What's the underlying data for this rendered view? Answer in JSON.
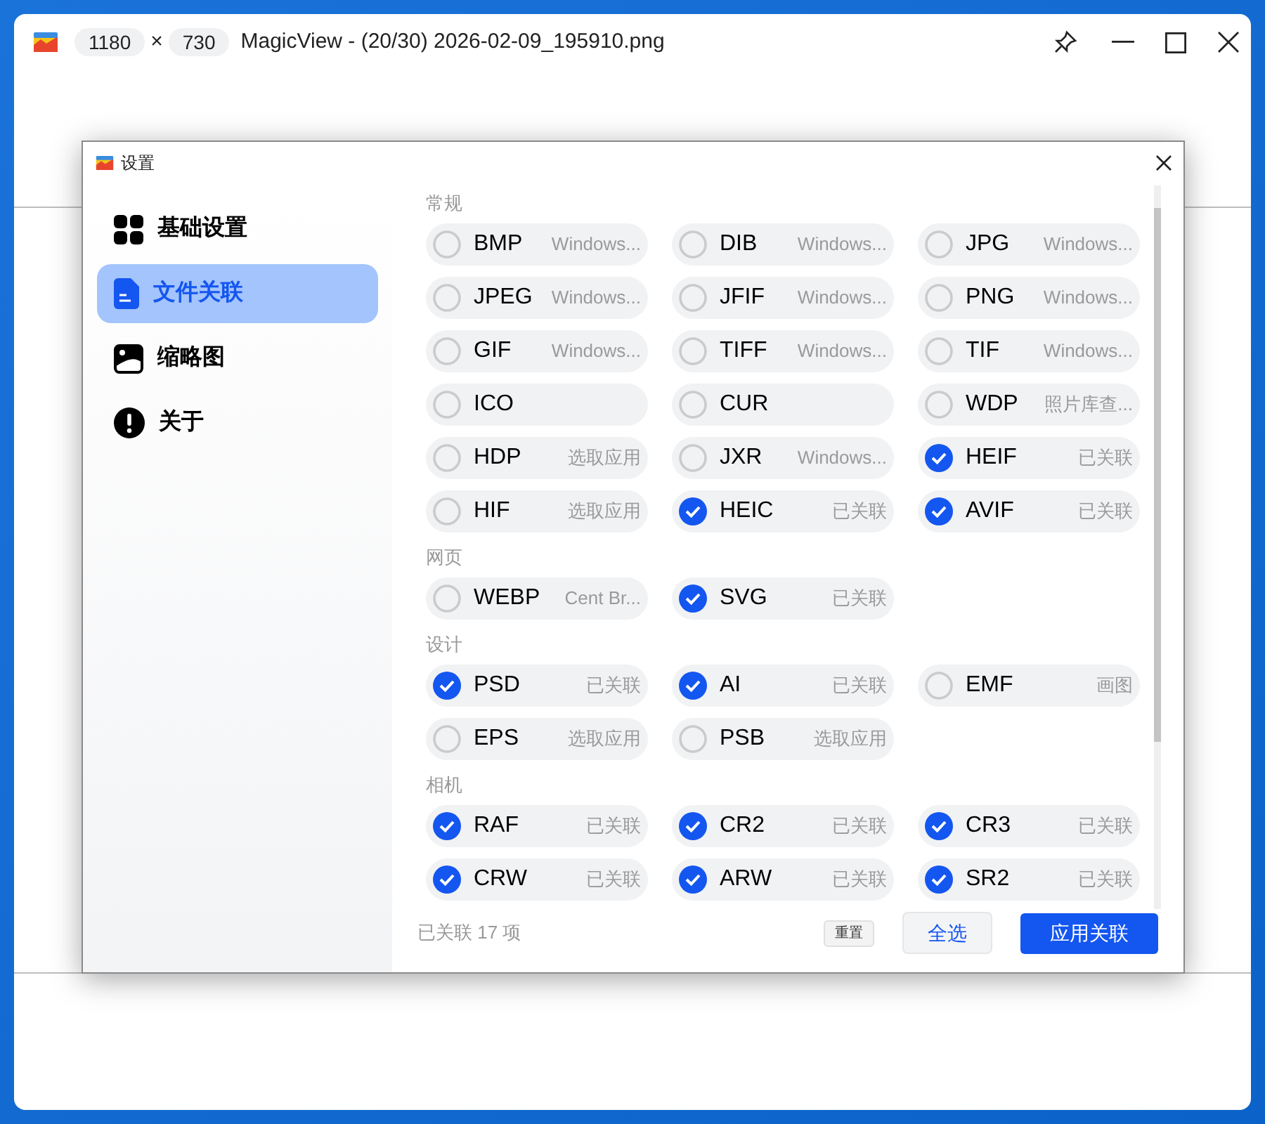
{
  "window": {
    "width_chip": "1180",
    "times": "×",
    "height_chip": "730",
    "title": "MagicView - (20/30) 2026-02-09_195910.png"
  },
  "dialog": {
    "title": "设置",
    "sidebar": [
      {
        "label": "基础设置",
        "selected": false
      },
      {
        "label": "文件关联",
        "selected": true
      },
      {
        "label": "缩略图",
        "selected": false
      },
      {
        "label": "关于",
        "selected": false
      }
    ],
    "sections": [
      {
        "title": "常规",
        "items": [
          {
            "label": "BMP",
            "app": "Windows...",
            "checked": false
          },
          {
            "label": "DIB",
            "app": "Windows...",
            "checked": false
          },
          {
            "label": "JPG",
            "app": "Windows...",
            "checked": false
          },
          {
            "label": "JPEG",
            "app": "Windows...",
            "checked": false
          },
          {
            "label": "JFIF",
            "app": "Windows...",
            "checked": false
          },
          {
            "label": "PNG",
            "app": "Windows...",
            "checked": false
          },
          {
            "label": "GIF",
            "app": "Windows...",
            "checked": false
          },
          {
            "label": "TIFF",
            "app": "Windows...",
            "checked": false
          },
          {
            "label": "TIF",
            "app": "Windows...",
            "checked": false
          },
          {
            "label": "ICO",
            "checked": false
          },
          {
            "label": "CUR",
            "checked": false
          },
          {
            "label": "WDP",
            "app": "照片库查...",
            "checked": false
          },
          {
            "label": "HDP",
            "app": "选取应用",
            "checked": false
          },
          {
            "label": "JXR",
            "app": "Windows...",
            "checked": false
          },
          {
            "label": "HEIF",
            "app": "已关联",
            "checked": true
          },
          {
            "label": "HIF",
            "app": "选取应用",
            "checked": false
          },
          {
            "label": "HEIC",
            "app": "已关联",
            "checked": true
          },
          {
            "label": "AVIF",
            "app": "已关联",
            "checked": true
          }
        ]
      },
      {
        "title": "网页",
        "items": [
          {
            "label": "WEBP",
            "app": "Cent Br...",
            "checked": false
          },
          {
            "label": "SVG",
            "app": "已关联",
            "checked": true
          }
        ]
      },
      {
        "title": "设计",
        "items": [
          {
            "label": "PSD",
            "app": "已关联",
            "checked": true
          },
          {
            "label": "AI",
            "app": "已关联",
            "checked": true
          },
          {
            "label": "EMF",
            "app": "画图",
            "checked": false
          },
          {
            "label": "EPS",
            "app": "选取应用",
            "checked": false
          },
          {
            "label": "PSB",
            "app": "选取应用",
            "checked": false
          }
        ]
      },
      {
        "title": "相机",
        "items": [
          {
            "label": "RAF",
            "app": "已关联",
            "checked": true
          },
          {
            "label": "CR2",
            "app": "已关联",
            "checked": true
          },
          {
            "label": "CR3",
            "app": "已关联",
            "checked": true
          },
          {
            "label": "CRW",
            "app": "已关联",
            "checked": true
          },
          {
            "label": "ARW",
            "app": "已关联",
            "checked": true
          },
          {
            "label": "SR2",
            "app": "已关联",
            "checked": true
          }
        ]
      }
    ],
    "status": "已关联 17 项",
    "buttons": [
      {
        "label": "重置",
        "kind": "tiny"
      },
      {
        "label": "全选",
        "kind": "secondary"
      },
      {
        "label": "应用关联",
        "kind": "primary"
      }
    ]
  }
}
